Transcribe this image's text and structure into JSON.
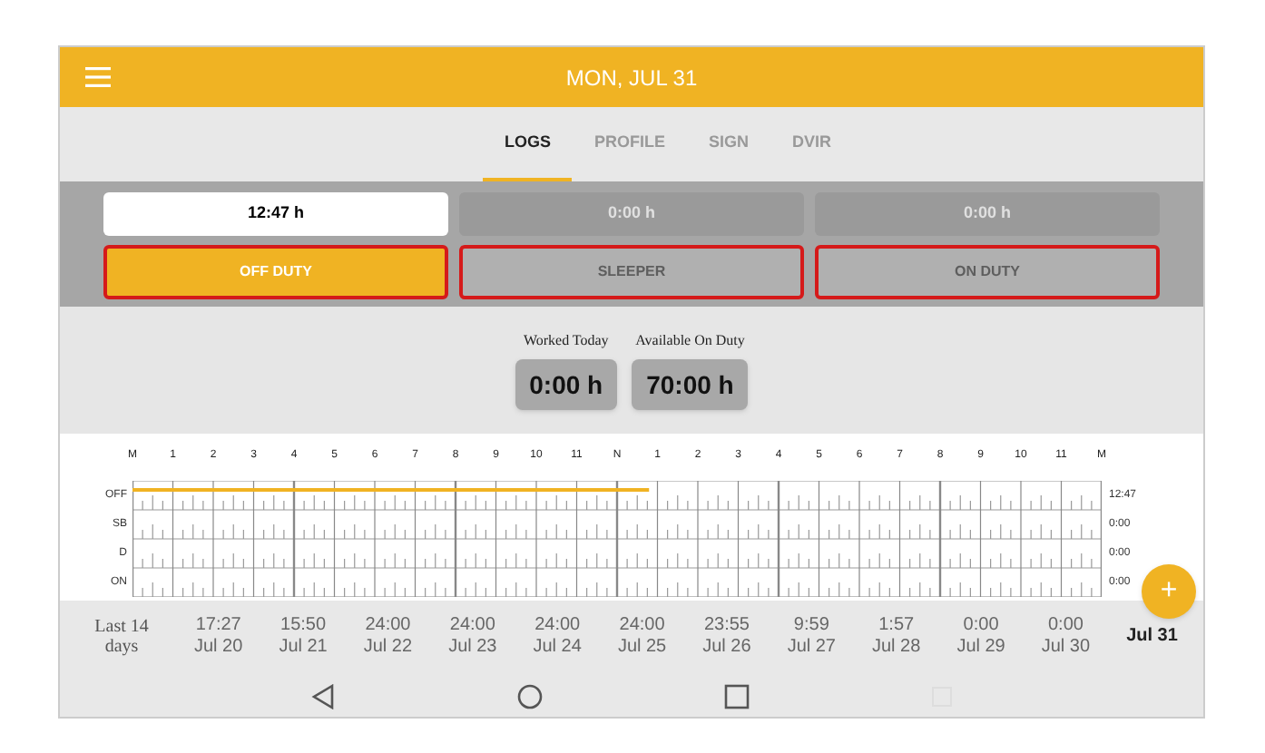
{
  "header": {
    "title": "MON, JUL 31"
  },
  "tabs": [
    {
      "label": "LOGS",
      "selected": true
    },
    {
      "label": "PROFILE",
      "selected": false
    },
    {
      "label": "SIGN",
      "selected": false
    },
    {
      "label": "DVIR",
      "selected": false
    }
  ],
  "statuses": [
    {
      "hours": "12:47 h",
      "label": "OFF DUTY",
      "selected": true
    },
    {
      "hours": "0:00 h",
      "label": "SLEEPER",
      "selected": false
    },
    {
      "hours": "0:00 h",
      "label": "ON DUTY",
      "selected": false
    }
  ],
  "summary": [
    {
      "label": "Worked Today",
      "value": "0:00 h"
    },
    {
      "label": "Available On Duty",
      "value": "70:00 h"
    }
  ],
  "graph": {
    "hours": [
      "M",
      "1",
      "2",
      "3",
      "4",
      "5",
      "6",
      "7",
      "8",
      "9",
      "10",
      "11",
      "N",
      "1",
      "2",
      "3",
      "4",
      "5",
      "6",
      "7",
      "8",
      "9",
      "10",
      "11",
      "M"
    ],
    "rows": [
      {
        "label": "OFF",
        "total": "12:47"
      },
      {
        "label": "SB",
        "total": "0:00"
      },
      {
        "label": "D",
        "total": "0:00"
      },
      {
        "label": "ON",
        "total": "0:00"
      }
    ],
    "line": {
      "level": 0.533
    }
  },
  "history": {
    "label": "Last 14 days",
    "days": [
      {
        "value": "17:27",
        "date": "Jul 20",
        "selected": false
      },
      {
        "value": "15:50",
        "date": "Jul 21",
        "selected": false
      },
      {
        "value": "24:00",
        "date": "Jul 22",
        "selected": false
      },
      {
        "value": "24:00",
        "date": "Jul 23",
        "selected": false
      },
      {
        "value": "24:00",
        "date": "Jul 24",
        "selected": false
      },
      {
        "value": "24:00",
        "date": "Jul 25",
        "selected": false
      },
      {
        "value": "23:55",
        "date": "Jul 26",
        "selected": false
      },
      {
        "value": "9:59",
        "date": "Jul 27",
        "selected": false
      },
      {
        "value": "1:57",
        "date": "Jul 28",
        "selected": false
      },
      {
        "value": "0:00",
        "date": "Jul 29",
        "selected": false
      },
      {
        "value": "0:00",
        "date": "Jul 30",
        "selected": false
      },
      {
        "date": "Jul 31",
        "selected": true
      }
    ]
  },
  "fab": {
    "label": "+"
  }
}
